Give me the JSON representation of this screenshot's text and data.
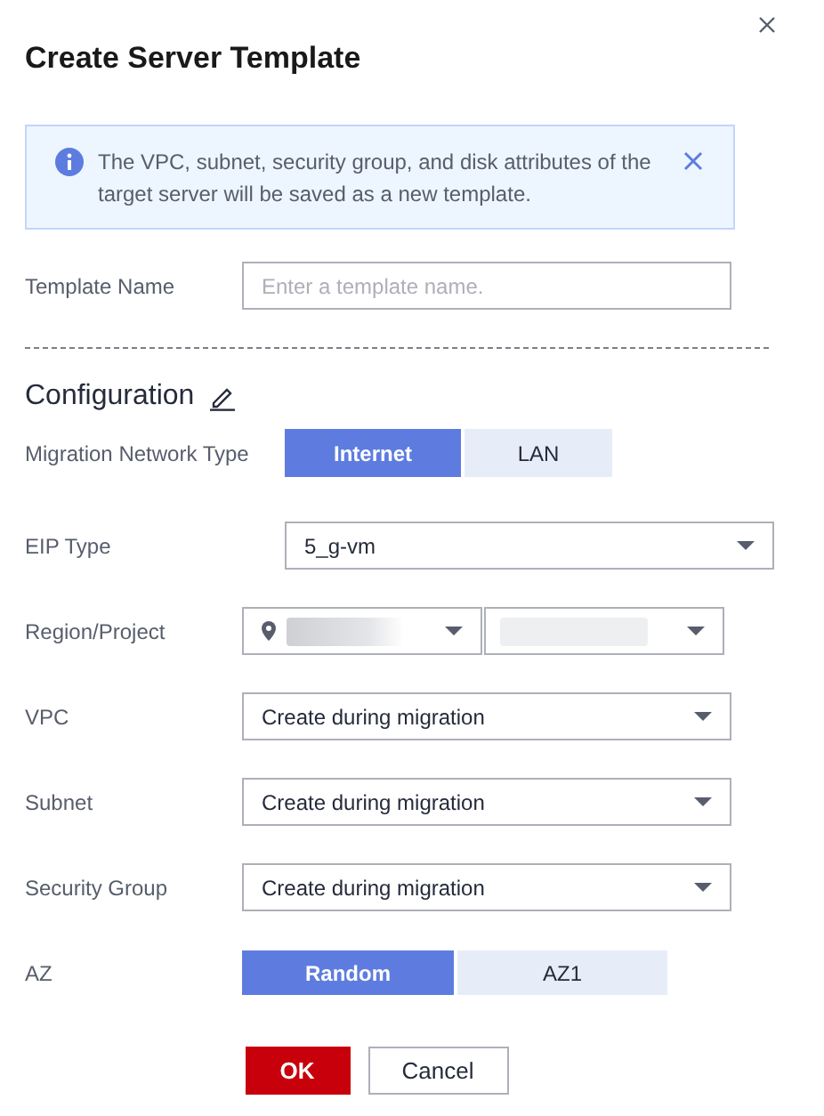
{
  "dialog": {
    "title": "Create Server Template"
  },
  "alert": {
    "text": "The VPC, subnet, security group, and disk attributes of the target server will be saved as a new template."
  },
  "template_name": {
    "label": "Template Name",
    "placeholder": "Enter a template name."
  },
  "configuration": {
    "heading": "Configuration",
    "fields": [
      {
        "kind": "segmented",
        "label": "Migration Network Type",
        "options": [
          {
            "label": "Internet",
            "selected": true
          },
          {
            "label": "LAN",
            "selected": false
          }
        ]
      },
      {
        "kind": "select",
        "label": "EIP Type",
        "value": "5_g-vm"
      },
      {
        "kind": "region",
        "label": "Region/Project"
      },
      {
        "kind": "select",
        "label": "VPC",
        "value": "Create during migration"
      },
      {
        "kind": "select",
        "label": "Subnet",
        "value": "Create during migration"
      },
      {
        "kind": "select",
        "label": "Security Group",
        "value": "Create during migration"
      },
      {
        "kind": "segmented",
        "label": "AZ",
        "options": [
          {
            "label": "Random",
            "selected": true
          },
          {
            "label": "AZ1",
            "selected": false
          }
        ]
      }
    ]
  },
  "buttons": [
    {
      "label": "OK",
      "kind": "primary"
    },
    {
      "label": "Cancel",
      "kind": "secondary"
    }
  ]
}
